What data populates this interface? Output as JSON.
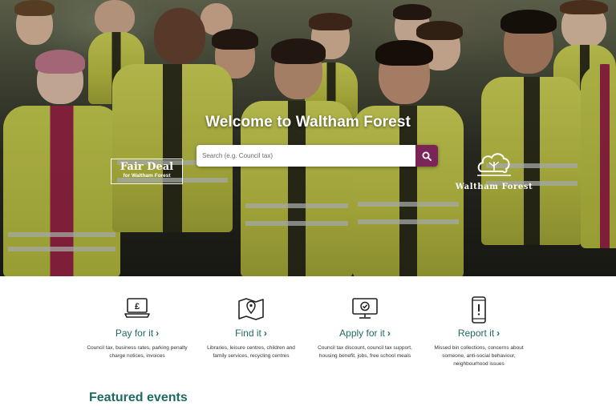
{
  "hero": {
    "title": "Welcome to Waltham Forest",
    "search": {
      "placeholder": "Search (e.g. Council tax)"
    },
    "fair_deal": {
      "main": "Fair Deal",
      "sub": "for Waltham Forest"
    },
    "brand": "Waltham Forest"
  },
  "services": [
    {
      "title": "Pay for it",
      "icon": "laptop-pound-icon",
      "description": "Council tax, business rates, parking penalty charge notices, invoices"
    },
    {
      "title": "Find it",
      "icon": "map-pin-icon",
      "description": "Libraries, leisure centres, children and family services, recycling centres"
    },
    {
      "title": "Apply for it",
      "icon": "monitor-check-icon",
      "description": "Council tax discount, council tax support, housing benefit, jobs, free school meals"
    },
    {
      "title": "Report it",
      "icon": "phone-alert-icon",
      "description": "Missed bin collections, concerns about someone, anti-social behaviour, neighbourhood issues"
    }
  ],
  "featured": {
    "heading": "Featured events"
  },
  "colors": {
    "accent": "#1f6b62",
    "search_button": "#7a2457",
    "vest": "#d7dc5a"
  }
}
